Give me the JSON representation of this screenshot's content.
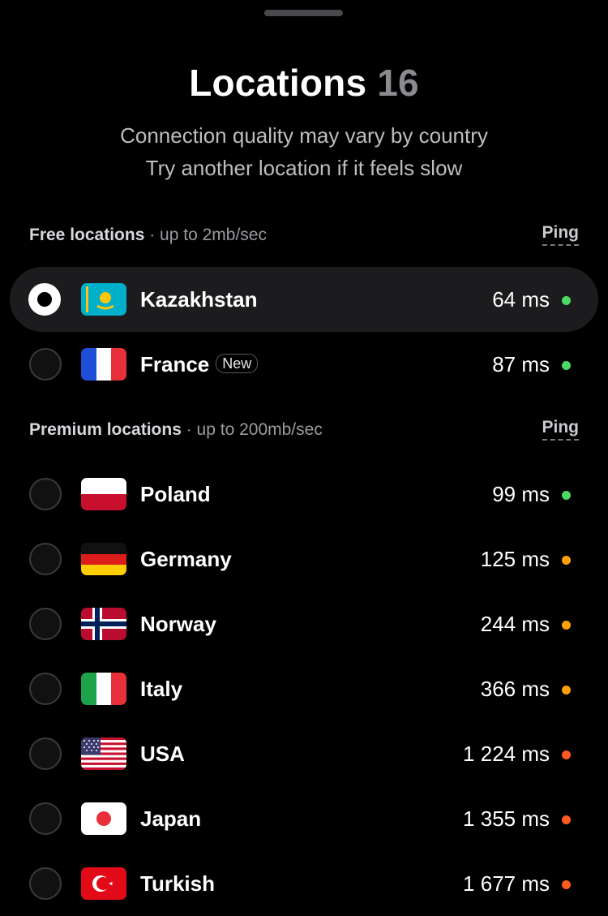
{
  "header": {
    "title": "Locations",
    "count": "16",
    "subtitle_line1": "Connection quality may vary by country",
    "subtitle_line2": "Try another location if it feels slow"
  },
  "sections": {
    "free": {
      "name": "Free locations",
      "speed": " · up to 2mb/sec",
      "ping_label": "Ping"
    },
    "premium": {
      "name": "Premium locations",
      "speed": " · up to 200mb/sec",
      "ping_label": "Ping"
    }
  },
  "status_colors": {
    "good": "#4cd964",
    "medium": "#ff9f0a",
    "bad": "#ff5a1f"
  },
  "free_locations": [
    {
      "country": "Kazakhstan",
      "flag": "kazakhstan-flag",
      "ping": "64 ms",
      "status": "good",
      "selected": true,
      "badge": ""
    },
    {
      "country": "France",
      "flag": "france-flag",
      "ping": "87 ms",
      "status": "good",
      "selected": false,
      "badge": "New"
    }
  ],
  "premium_locations": [
    {
      "country": "Poland",
      "flag": "poland-flag",
      "ping": "99 ms",
      "status": "good",
      "selected": false
    },
    {
      "country": "Germany",
      "flag": "germany-flag",
      "ping": "125 ms",
      "status": "medium",
      "selected": false
    },
    {
      "country": "Norway",
      "flag": "norway-flag",
      "ping": "244 ms",
      "status": "medium",
      "selected": false
    },
    {
      "country": "Italy",
      "flag": "italy-flag",
      "ping": "366 ms",
      "status": "medium",
      "selected": false
    },
    {
      "country": "USA",
      "flag": "usa-flag",
      "ping": "1 224 ms",
      "status": "bad",
      "selected": false
    },
    {
      "country": "Japan",
      "flag": "japan-flag",
      "ping": "1 355 ms",
      "status": "bad",
      "selected": false
    },
    {
      "country": "Turkish",
      "flag": "turkey-flag",
      "ping": "1 677 ms",
      "status": "bad",
      "selected": false
    }
  ]
}
